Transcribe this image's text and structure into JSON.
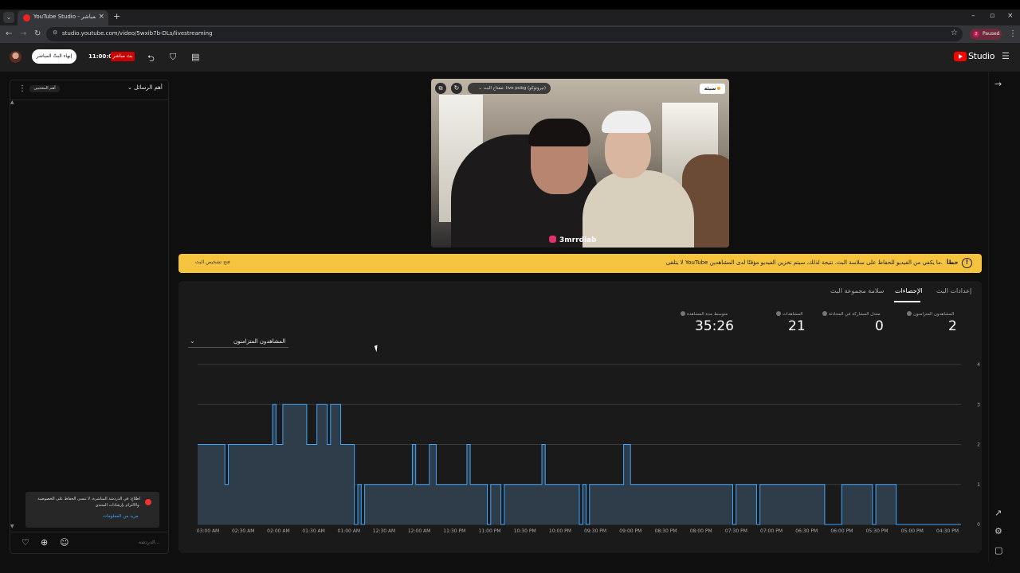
{
  "browser": {
    "tab_title": "YouTube Studio - البث المباشر",
    "url": "studio.youtube.com/video/5wxib7b-DLs/livestreaming",
    "profile_label": "Paused",
    "profile_initial": "2"
  },
  "header": {
    "end_stream_label": "إنهاء البثّ المباشر",
    "timer": "11:00:05",
    "live_badge": "بث مباشر",
    "logo_text": "Studio"
  },
  "chat": {
    "title": "أهم الرسائل",
    "pill": "أهم المعجبين",
    "notice_text": "اطلاع: في الدردشة المباشرة، لا تنسى الحفاظ على الخصوصية والالتزام بإرشادات المنتدى.",
    "notice_link": "مزيد من المعلومات",
    "input_placeholder": "الدردشة..."
  },
  "preview": {
    "status_badge": "سيئة",
    "stream_key": "مفتاح البث: live pubg (تيروتوكو)",
    "handle": "3mrrdiab"
  },
  "banner": {
    "title": "خطأ",
    "message": "لا يتلقى YouTube ما يكفي من الفيديو للحفاظ على سلاسة البث. نتيجة لذلك، سيتم تخزين الفيديو مؤقتًا لدى المشاهدين.",
    "link": "فتح تشخيص البث"
  },
  "tabs": [
    "إعدادات البث",
    "الإحصاءات",
    "سلامة مجموعة البث"
  ],
  "metrics": [
    {
      "label": "المشاهدون المتزامنون",
      "value": "2"
    },
    {
      "label": "معدل المشاركة في المحادثة",
      "value": "0"
    },
    {
      "label": "المشاهدات",
      "value": "21"
    },
    {
      "label": "متوسط مدة المشاهدة",
      "value": "35:26"
    }
  ],
  "select_label": "المشاهدون المتزامنون",
  "chart_data": {
    "type": "area",
    "color": "#3ea6ff",
    "ylim": [
      0,
      4
    ],
    "yticks": [
      "0",
      "1",
      "2",
      "3",
      "4"
    ],
    "xticks": [
      "03:00 AM",
      "02:30 AM",
      "02:00 AM",
      "01:30 AM",
      "01:00 AM",
      "12:30 AM",
      "12:00 AM",
      "11:30 PM",
      "11:00 PM",
      "10:30 PM",
      "10:00 PM",
      "09:30 PM",
      "09:00 PM",
      "08:30 PM",
      "08:00 PM",
      "07:30 PM",
      "07:00 PM",
      "06:30 PM",
      "06:00 PM",
      "05:30 PM",
      "05:00 PM",
      "04:30 PM"
    ],
    "series": [
      {
        "values": [
          2,
          2,
          2,
          2,
          2,
          2,
          2,
          2,
          1,
          2,
          2,
          2,
          2,
          2,
          2,
          2,
          2,
          2,
          2,
          2,
          2,
          2,
          3,
          2,
          2,
          3,
          3,
          3,
          3,
          3,
          3,
          3,
          2,
          2,
          2,
          3,
          3,
          3,
          2,
          3,
          3,
          3,
          2,
          2,
          2,
          2,
          0,
          1,
          0,
          1,
          1,
          1,
          1,
          1,
          1,
          1,
          1,
          1,
          1,
          1,
          1,
          1,
          1,
          2,
          1,
          1,
          1,
          1,
          2,
          2,
          1,
          1,
          1,
          1,
          1,
          1,
          1,
          1,
          1,
          2,
          1,
          1,
          1,
          1,
          1,
          0,
          1,
          1,
          1,
          0,
          1,
          1,
          1,
          1,
          1,
          1,
          1,
          1,
          1,
          1,
          1,
          2,
          1,
          1,
          1,
          1,
          1,
          1,
          1,
          1,
          1,
          1,
          0,
          1,
          0,
          1,
          1,
          1,
          1,
          1,
          1,
          1,
          1,
          1,
          1,
          2,
          2,
          1,
          1,
          1,
          1,
          1,
          1,
          1,
          1,
          1,
          1,
          1,
          1,
          1,
          1,
          1,
          1,
          1,
          1,
          1,
          1,
          1,
          1,
          1,
          1,
          1,
          1,
          1,
          1,
          1,
          1,
          0,
          1,
          1,
          1,
          1,
          1,
          1,
          0,
          1,
          1,
          1,
          1,
          1,
          1,
          1,
          1,
          1,
          1,
          1,
          1,
          1,
          1,
          1,
          1,
          1,
          1,
          1,
          0,
          0,
          0,
          0,
          0,
          1,
          1,
          1,
          1,
          1,
          1,
          1,
          1,
          1,
          0,
          1,
          1,
          1,
          1,
          1,
          1,
          0,
          0,
          0,
          0,
          0,
          0,
          0,
          0,
          0,
          0,
          0,
          0,
          0,
          0,
          0,
          0,
          0,
          0,
          0
        ]
      }
    ]
  }
}
